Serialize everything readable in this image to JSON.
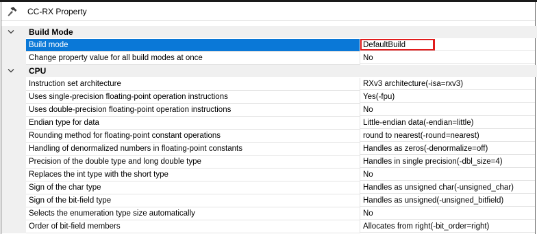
{
  "window": {
    "title": "CC-RX Property"
  },
  "categories": [
    {
      "label": "Build Mode",
      "rows": [
        {
          "name": "Build mode",
          "value": "DefaultBuild"
        },
        {
          "name": "Change property value for all build modes at once",
          "value": "No"
        }
      ]
    },
    {
      "label": "CPU",
      "rows": [
        {
          "name": "Instruction set architecture",
          "value": "RXv3 architecture(-isa=rxv3)"
        },
        {
          "name": "Uses single-precision floating-point operation instructions",
          "value": "Yes(-fpu)"
        },
        {
          "name": "Uses double-precision floating-point operation instructions",
          "value": "No"
        },
        {
          "name": "Endian type for data",
          "value": "Little-endian data(-endian=little)"
        },
        {
          "name": "Rounding method for floating-point constant operations",
          "value": "round to nearest(-round=nearest)"
        },
        {
          "name": "Handling of denormalized numbers in floating-point constants",
          "value": "Handles as zeros(-denormalize=off)"
        },
        {
          "name": "Precision of the double type and long double type",
          "value": "Handles in single precision(-dbl_size=4)"
        },
        {
          "name": "Replaces the int type with the short type",
          "value": "No"
        },
        {
          "name": "Sign of the char type",
          "value": "Handles as unsigned char(-unsigned_char)"
        },
        {
          "name": "Sign of the bit-field type",
          "value": "Handles as unsigned(-unsigned_bitfield)"
        },
        {
          "name": "Selects the enumeration type size automatically",
          "value": "No"
        },
        {
          "name": "Order of bit-field members",
          "value": "Allocates from right(-bit_order=right)"
        }
      ]
    }
  ],
  "colors": {
    "selection": "#0a78d7",
    "highlight_box": "#e11c1c",
    "gutter": "#f0f0f0"
  },
  "icons": {
    "title": "hammer-icon",
    "category_toggle": "chevron-down-icon"
  }
}
